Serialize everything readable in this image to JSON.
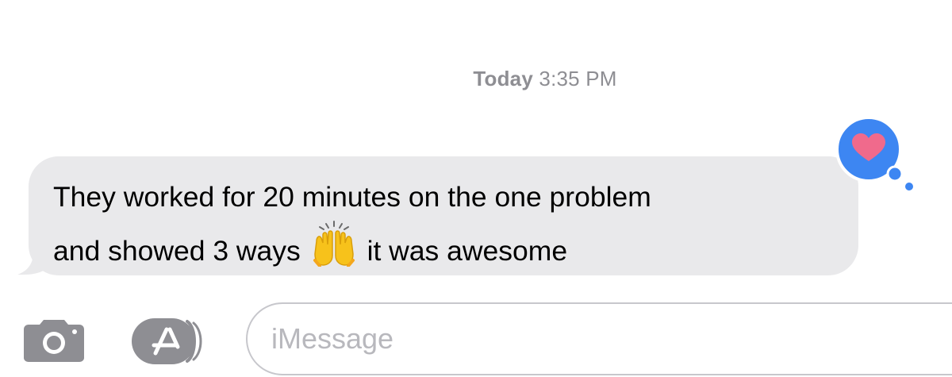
{
  "conversation": {
    "timestamp": {
      "day": "Today",
      "time": "3:35 PM"
    },
    "messages": [
      {
        "direction": "incoming",
        "line1": "They worked for 20 minutes on the one problem",
        "line2_before_emoji": "and showed 3 ways",
        "emoji": "raising-hands-emoji",
        "line2_after_emoji": "it was awesome",
        "tapback": {
          "icon": "heart-icon",
          "color": "#f06a8c",
          "bubble_color": "#3d86f2"
        }
      }
    ]
  },
  "compose_bar": {
    "camera_icon": "camera-icon",
    "app_store_icon": "app-store-icon",
    "input_placeholder": "iMessage"
  }
}
